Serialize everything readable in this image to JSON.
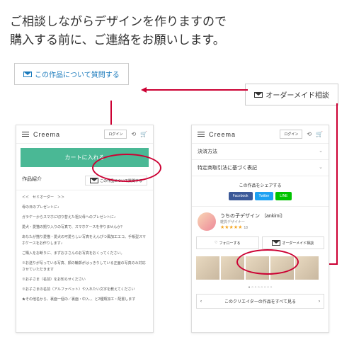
{
  "headline_l1": "ご相談しながらデザインを作りますので",
  "headline_l2": "購入する前に、ご連絡をお願いします。",
  "question_btn": "この作品について質問する",
  "order_btn": "オーダーメイド相談",
  "phone": {
    "logo": "Creema",
    "login": "ログイン",
    "cart_label": "カートに入れる",
    "intro_label": "作品紹介",
    "mini_q": "この作品について質問する",
    "semi": "＜＜　セミオーダー　＞＞",
    "p1": "母の日のプレゼントに♪",
    "p2": "ガラケーからスマホに切り替えた祖父母へのプレゼントに♪",
    "p3": "愛犬・愛猫の拠り入りの写真で、スマホケースを作りませんか？",
    "p4": "あなたが描り愛猫・愛犬の可愛らしい写真をえんぴつ風加工エコ、手帳型スマホケースをお作りします♪",
    "p5": "ご購入をお断りに、まずお子さんのお写真をおくってください。",
    "p6": "※お送りが写っている写真、顔の輪郭がはっきりしている正面の写真のみ対応させていただきます",
    "p7": "※お子さま（名前）をお知らせください",
    "p8": "※お子さまの名前（アルファベット）や入れたい文字を教えてください",
    "p9": "★その他名から、裏面一個の／裏面・中入、、と2種類加工・配置します",
    "pay_method": "決済方法",
    "law": "特定商取引法に基づく表記",
    "share": "この作品をシェアする",
    "fb": "Facebook",
    "tw": "Twitter",
    "ln": "LINE",
    "creator_name": "うちの子デザイン 〔ankimi〕",
    "creator_sub": "雑貨デザイナー",
    "stars": "★★★★★",
    "star_count": "18",
    "follow": "フォローする",
    "order_made": "オーダーメイド相談",
    "see_all": "このクリエイターの作品をすべて見る",
    "dots": "● ○ ○ ○ ○ ○ ○ ○"
  }
}
